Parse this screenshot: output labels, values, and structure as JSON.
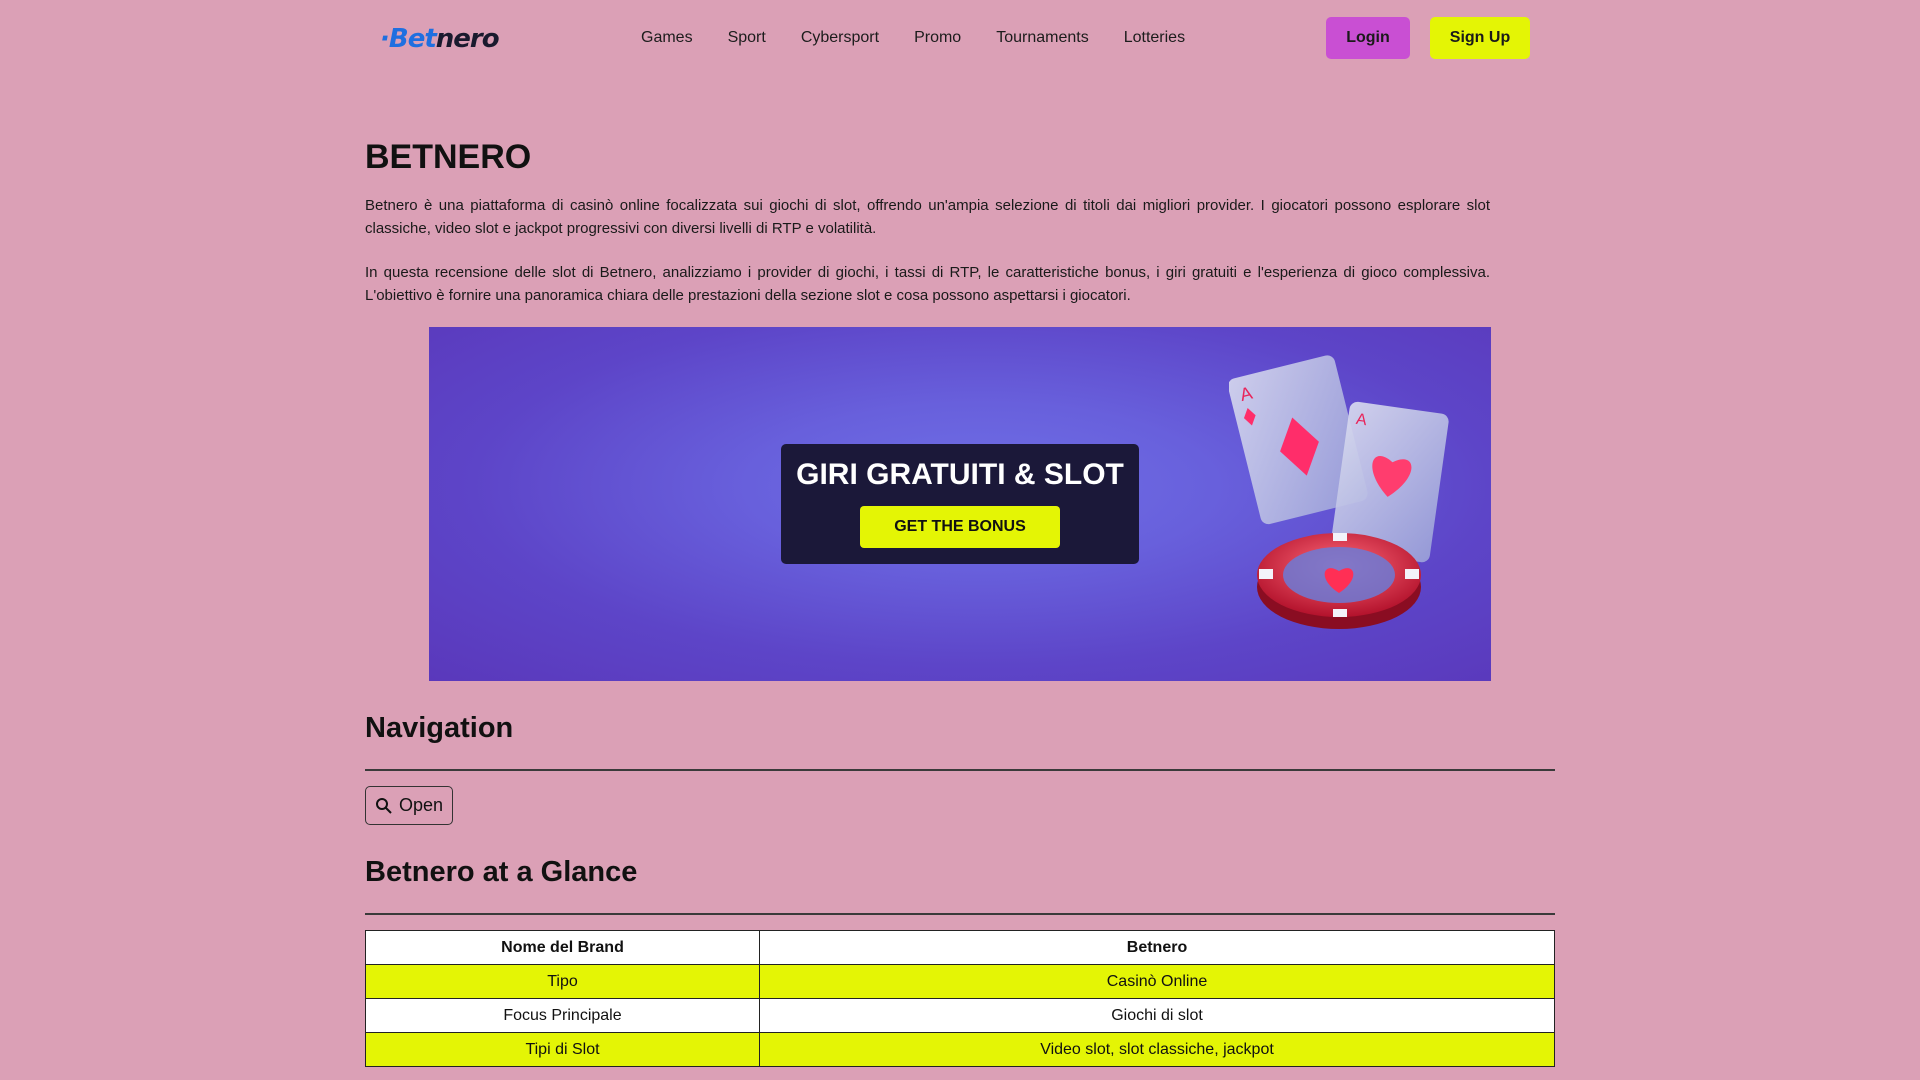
{
  "header": {
    "logo": {
      "prefix": "Bet",
      "suffix": "nero"
    },
    "nav": [
      "Games",
      "Sport",
      "Cybersport",
      "Promo",
      "Tournaments",
      "Lotteries"
    ],
    "login_label": "Login",
    "signup_label": "Sign Up"
  },
  "main": {
    "title": "BETNERO",
    "paragraph1": "Betnero è una piattaforma di casinò online focalizzata sui giochi di slot, offrendo un'ampia selezione di titoli dai migliori provider. I giocatori possono esplorare slot classiche, video slot e jackpot progressivi con diversi livelli di RTP e volatilità.",
    "paragraph2": "In questa recensione delle slot di Betnero, analizziamo i provider di giochi, i tassi di RTP, le caratteristiche bonus, i giri gratuiti e l'esperienza di gioco complessiva. L'obiettivo è fornire una panoramica chiara delle prestazioni della sezione slot e cosa possono aspettarsi i giocatori."
  },
  "banner": {
    "title": "GIRI GRATUITI & SLOT",
    "button_label": "GET THE BONUS"
  },
  "navigation": {
    "heading": "Navigation",
    "open_label": "Open"
  },
  "glance": {
    "heading": "Betnero at a Glance",
    "header_row": [
      "Nome del Brand",
      "Betnero"
    ],
    "rows": [
      [
        "Tipo",
        "Casinò Online"
      ],
      [
        "Focus Principale",
        "Giochi di slot"
      ],
      [
        "Tipi di Slot",
        "Video slot, slot classiche, jackpot"
      ]
    ]
  },
  "colors": {
    "background": "#dba0b6",
    "accent_yellow": "#e4f505",
    "accent_purple": "#c94fd3",
    "promo_box": "#1b1839"
  }
}
